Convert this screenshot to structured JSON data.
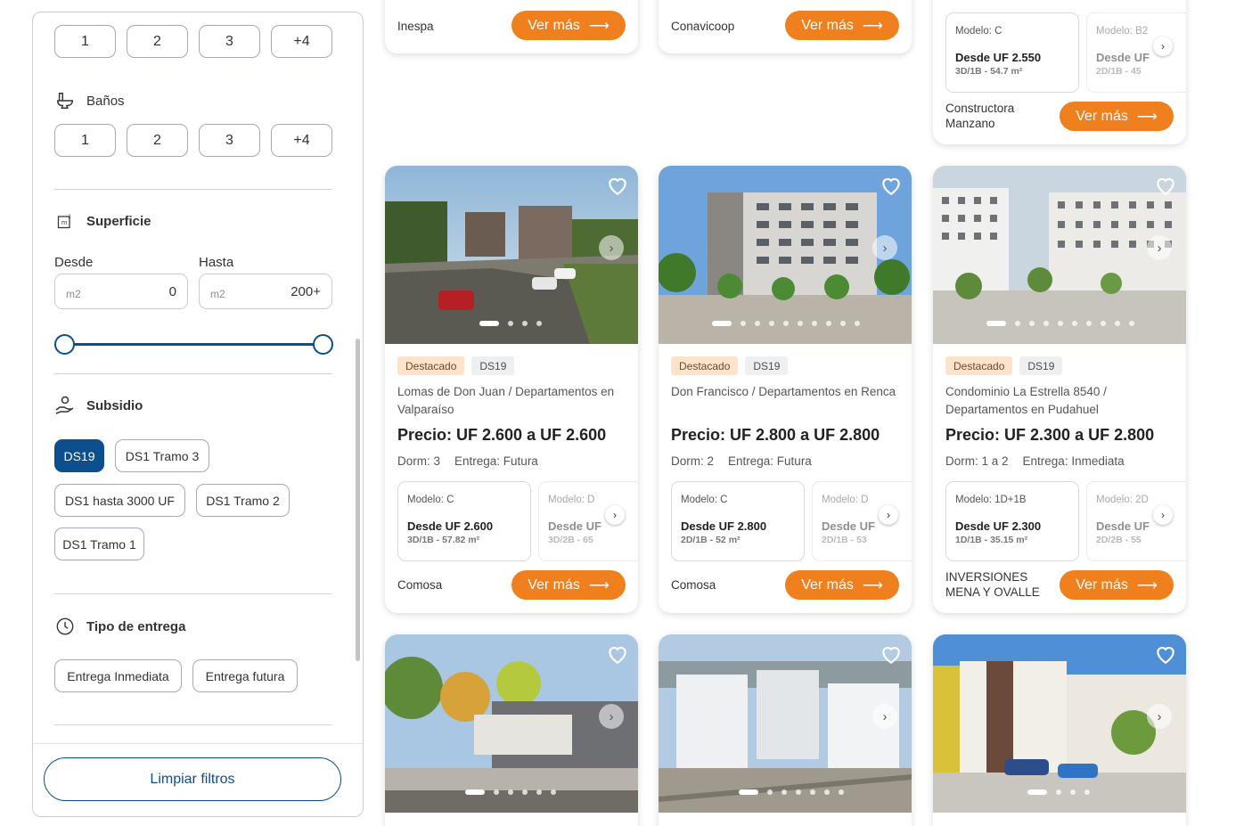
{
  "sidebar": {
    "dorm_pills": [
      "1",
      "2",
      "3",
      "+4"
    ],
    "banos": {
      "label": "Baños",
      "pills": [
        "1",
        "2",
        "3",
        "+4"
      ]
    },
    "superficie": {
      "title": "Superficie",
      "desde_label": "Desde",
      "hasta_label": "Hasta",
      "unit": "m2",
      "desde_value": "0",
      "hasta_value": "200+"
    },
    "subsidio": {
      "title": "Subsidio",
      "chips": [
        "DS19",
        "DS1 Tramo 3",
        "DS1 hasta 3000 UF",
        "DS1 Tramo 2",
        "DS1 Tramo 1"
      ],
      "active": "DS19"
    },
    "entrega": {
      "title": "Tipo de entrega",
      "chips": [
        "Entrega Inmediata",
        "Entrega futura"
      ]
    },
    "clear_button": "Limpiar filtros"
  },
  "colors": {
    "accent": "#f07f1e",
    "primary": "#0d4e8c"
  },
  "cards": [
    {
      "builder": "Inespa",
      "button": "Ver más"
    },
    {
      "builder": "Conavicoop",
      "button": "Ver más"
    },
    {
      "models": [
        {
          "name": "Modelo: C",
          "price": "Desde UF 2.550",
          "spec": "3D/1B - 54.7 m²"
        },
        {
          "name": "Modelo: B2",
          "price": "Desde UF",
          "spec": "2D/1B - 45"
        }
      ],
      "builder": "Constructora Manzano",
      "button": "Ver más"
    },
    {
      "tags": [
        "Destacado",
        "DS19"
      ],
      "title": "Lomas de Don Juan / Departamentos en Valparaíso",
      "price": "Precio: UF 2.600 a UF 2.600",
      "dorm": "Dorm: 3",
      "entrega": "Entrega: Futura",
      "models": [
        {
          "name": "Modelo: C",
          "price": "Desde UF 2.600",
          "spec": "3D/1B - 57.82 m²"
        },
        {
          "name": "Modelo: D",
          "price": "Desde UF",
          "spec": "3D/2B - 65"
        }
      ],
      "builder": "Comosa",
      "button": "Ver más"
    },
    {
      "tags": [
        "Destacado",
        "DS19"
      ],
      "title": "Don Francisco / Departamentos en Renca",
      "price": "Precio: UF 2.800 a UF 2.800",
      "dorm": "Dorm: 2",
      "entrega": "Entrega: Futura",
      "models": [
        {
          "name": "Modelo: C",
          "price": "Desde UF 2.800",
          "spec": "2D/1B - 52 m²"
        },
        {
          "name": "Modelo: D",
          "price": "Desde UF",
          "spec": "2D/1B - 53"
        }
      ],
      "builder": "Comosa",
      "button": "Ver más"
    },
    {
      "tags": [
        "Destacado",
        "DS19"
      ],
      "title": "Condominio La Estrella 8540 / Departamentos en Pudahuel",
      "price": "Precio: UF 2.300 a UF 2.800",
      "dorm": "Dorm: 1 a 2",
      "entrega": "Entrega: Inmediata",
      "models": [
        {
          "name": "Modelo: 1D+1B",
          "price": "Desde UF 2.300",
          "spec": "1D/1B - 35.15 m²"
        },
        {
          "name": "Modelo: 2D",
          "price": "Desde UF",
          "spec": "2D/2B - 55"
        }
      ],
      "builder": "INVERSIONES MENA Y OVALLE",
      "button": "Ver más"
    }
  ]
}
